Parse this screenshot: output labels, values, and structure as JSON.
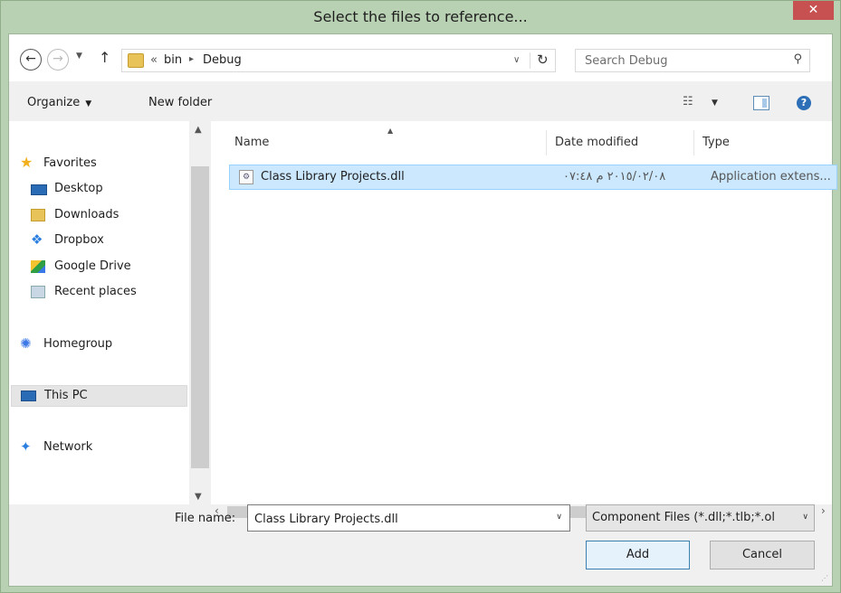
{
  "window": {
    "title": "Select the files to reference...",
    "close_label": "✕"
  },
  "address": {
    "breadcrumb_prefix": "«",
    "segments": [
      "bin",
      "Debug"
    ],
    "separator": "▸"
  },
  "search": {
    "placeholder": "Search Debug"
  },
  "toolbar": {
    "organize_label": "Organize",
    "new_folder_label": "New folder"
  },
  "nav": {
    "favorites": "Favorites",
    "items": [
      {
        "label": "Desktop",
        "icon": "desktop-icon"
      },
      {
        "label": "Downloads",
        "icon": "downloads-icon"
      },
      {
        "label": "Dropbox",
        "icon": "dropbox-icon"
      },
      {
        "label": "Google Drive",
        "icon": "google-drive-icon"
      },
      {
        "label": "Recent places",
        "icon": "recent-places-icon"
      }
    ],
    "homegroup": "Homegroup",
    "this_pc": "This PC",
    "network": "Network"
  },
  "file_list": {
    "columns": [
      "Name",
      "Date modified",
      "Type"
    ],
    "rows": [
      {
        "name": "Class Library Projects.dll",
        "date_modified": "٢٠١٥/٠٢/٠٨ م ٠٧:٤٨",
        "type": "Application extens..."
      }
    ]
  },
  "bottom": {
    "file_name_label": "File name:",
    "file_name_value": "Class Library Projects.dll",
    "filter_value": "Component Files (*.dll;*.tlb;*.ol",
    "add_label": "Add",
    "cancel_label": "Cancel"
  },
  "colors": {
    "title_bar": "#b9d1b3",
    "close_button": "#c75050",
    "selection": "#cce8ff",
    "selection_border": "#99d1ff"
  }
}
